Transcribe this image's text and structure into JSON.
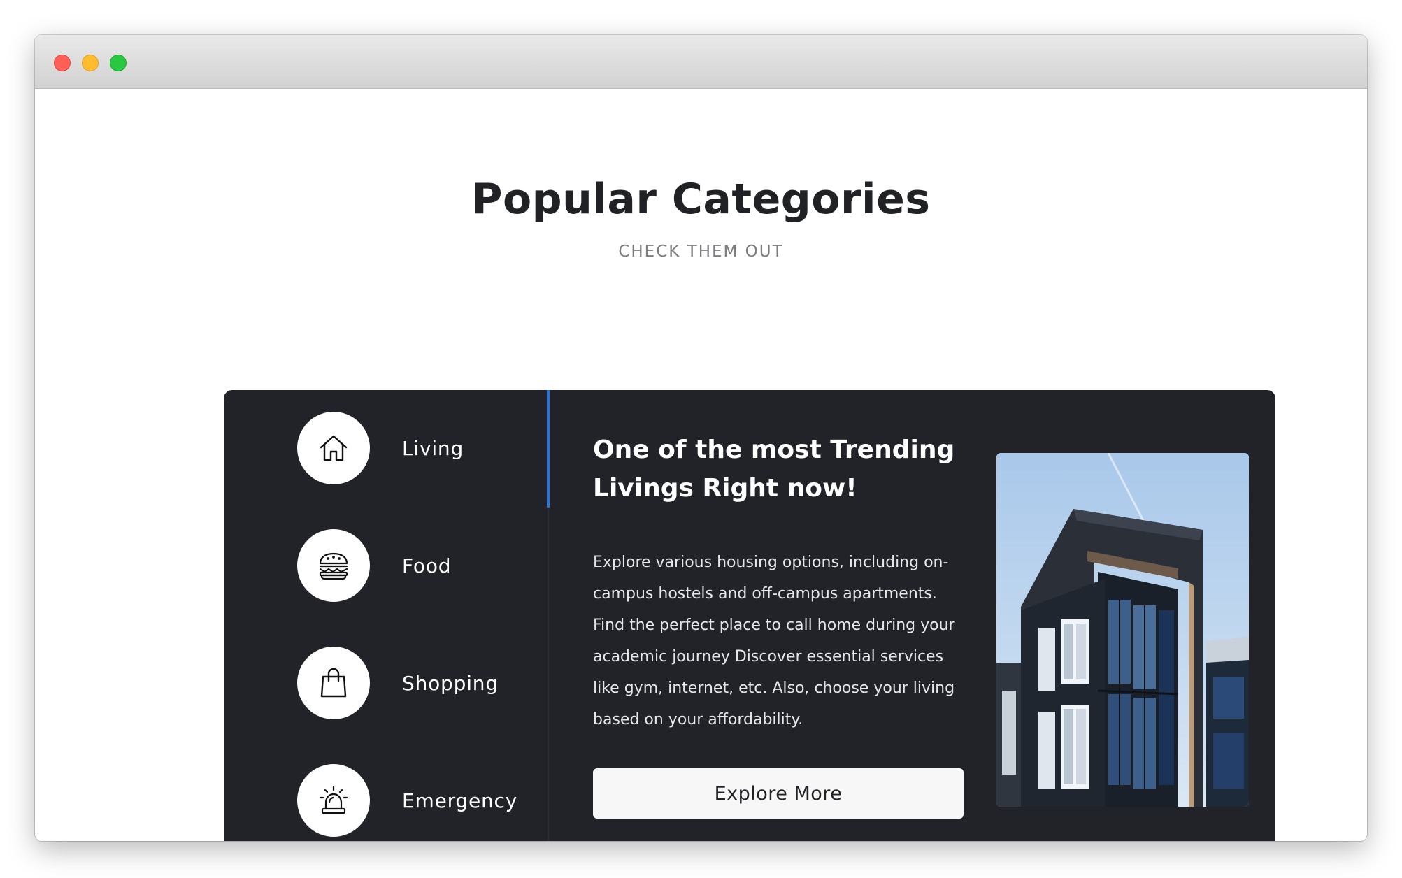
{
  "window": {
    "controls": [
      "close",
      "minimize",
      "zoom"
    ]
  },
  "header": {
    "title": "Popular Categories",
    "subtitle": "CHECK THEM OUT"
  },
  "categories": [
    {
      "label": "Living",
      "icon": "house-icon",
      "active": true
    },
    {
      "label": "Food",
      "icon": "burger-icon",
      "active": false
    },
    {
      "label": "Shopping",
      "icon": "shopping-bag-icon",
      "active": false
    },
    {
      "label": "Emergency",
      "icon": "siren-icon",
      "active": false
    }
  ],
  "detail": {
    "title": "One of the most Trending Livings Right now!",
    "description": "Explore various housing options, including on-campus hostels and off-campus apartments. Find the perfect place to call home during your academic journey Discover essential services like gym, internet, etc. Also, choose your living based on your affordability.",
    "button_label": "Explore More",
    "image": "modern-apartment-building-photo"
  },
  "colors": {
    "panel_bg": "#212328",
    "accent": "#2d73d8",
    "title_text": "#212226",
    "subtitle_text": "#7b7d80"
  }
}
